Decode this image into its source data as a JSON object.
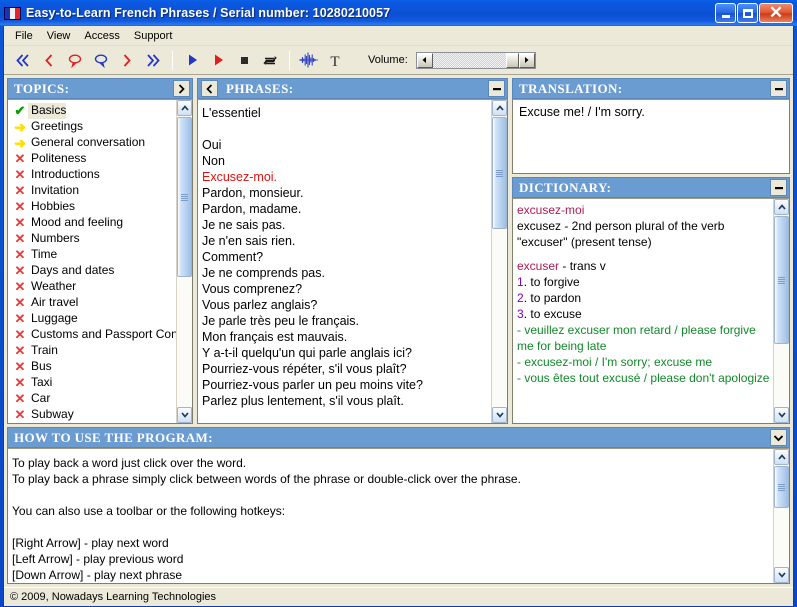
{
  "window": {
    "title": "Easy-to-Learn French Phrases / Serial number: 10280210057",
    "icon": "french-flag-icon",
    "buttons": {
      "minimize": "minimize",
      "maximize": "maximize",
      "close": "close"
    }
  },
  "menu": {
    "items": [
      "File",
      "View",
      "Access",
      "Support"
    ]
  },
  "toolbar": {
    "buttons": [
      {
        "name": "first-phrase-button",
        "icon": "double-chevron-left-icon",
        "color": "#2436c8"
      },
      {
        "name": "previous-word-button",
        "icon": "chevron-left-icon",
        "color": "#e02020"
      },
      {
        "name": "previous-phrase-button",
        "icon": "speech-bubble-left-icon",
        "color": "#e02020"
      },
      {
        "name": "next-phrase-button",
        "icon": "speech-bubble-right-icon",
        "color": "#2436c8"
      },
      {
        "name": "next-word-button",
        "icon": "chevron-right-icon",
        "color": "#e02020"
      },
      {
        "name": "last-phrase-button",
        "icon": "double-chevron-right-icon",
        "color": "#2436c8"
      },
      {
        "name": "play-button",
        "icon": "play-triangle-blue-icon",
        "color": "#2436c8"
      },
      {
        "name": "record-button",
        "icon": "play-triangle-red-icon",
        "color": "#e02020"
      },
      {
        "name": "stop-button",
        "icon": "stop-square-icon",
        "color": "#2b2b2b"
      },
      {
        "name": "repeat-button",
        "icon": "repeat-loop-icon",
        "color": "#1a1a1a"
      },
      {
        "name": "waveform-button",
        "icon": "waveform-icon",
        "color": "#2436c8"
      },
      {
        "name": "text-button",
        "icon": "text-t-icon",
        "color": "#2b2b2b"
      }
    ],
    "volume_label": "Volume:",
    "volume_value": 100
  },
  "topics": {
    "header": "TOPICS:",
    "expand_button": "›",
    "items": [
      {
        "label": "Basics",
        "status": "done",
        "icon": "check-icon",
        "selected": true
      },
      {
        "label": "Greetings",
        "status": "arrow",
        "icon": "arrow-right-icon",
        "selected": false
      },
      {
        "label": "General conversation",
        "status": "arrow",
        "icon": "arrow-right-icon",
        "selected": false
      },
      {
        "label": "Politeness",
        "status": "cross",
        "icon": "cross-icon",
        "selected": false
      },
      {
        "label": "Introductions",
        "status": "cross",
        "icon": "cross-icon",
        "selected": false
      },
      {
        "label": "Invitation",
        "status": "cross",
        "icon": "cross-icon",
        "selected": false
      },
      {
        "label": "Hobbies",
        "status": "cross",
        "icon": "cross-icon",
        "selected": false
      },
      {
        "label": "Mood and feeling",
        "status": "cross",
        "icon": "cross-icon",
        "selected": false
      },
      {
        "label": "Numbers",
        "status": "cross",
        "icon": "cross-icon",
        "selected": false
      },
      {
        "label": "Time",
        "status": "cross",
        "icon": "cross-icon",
        "selected": false
      },
      {
        "label": "Days and dates",
        "status": "cross",
        "icon": "cross-icon",
        "selected": false
      },
      {
        "label": "Weather",
        "status": "cross",
        "icon": "cross-icon",
        "selected": false
      },
      {
        "label": "Air travel",
        "status": "cross",
        "icon": "cross-icon",
        "selected": false
      },
      {
        "label": "Luggage",
        "status": "cross",
        "icon": "cross-icon",
        "selected": false
      },
      {
        "label": "Customs and Passport Con...",
        "status": "cross",
        "icon": "cross-icon",
        "selected": false
      },
      {
        "label": "Train",
        "status": "cross",
        "icon": "cross-icon",
        "selected": false
      },
      {
        "label": "Bus",
        "status": "cross",
        "icon": "cross-icon",
        "selected": false
      },
      {
        "label": "Taxi",
        "status": "cross",
        "icon": "cross-icon",
        "selected": false
      },
      {
        "label": "Car",
        "status": "cross",
        "icon": "cross-icon",
        "selected": false
      },
      {
        "label": "Subway",
        "status": "cross",
        "icon": "cross-icon",
        "selected": false
      }
    ]
  },
  "phrases": {
    "header": "PHRASES:",
    "collapse_left_button": "‹",
    "minimize_button": "–",
    "lines": [
      {
        "text": "L'essentiel",
        "highlight": false
      },
      {
        "text": "",
        "highlight": false
      },
      {
        "text": "Oui",
        "highlight": false
      },
      {
        "text": "Non",
        "highlight": false
      },
      {
        "text": "Excusez-moi.",
        "highlight": true
      },
      {
        "text": "Pardon, monsieur.",
        "highlight": false
      },
      {
        "text": "Pardon, madame.",
        "highlight": false
      },
      {
        "text": "Je ne sais pas.",
        "highlight": false
      },
      {
        "text": "Je n'en sais rien.",
        "highlight": false
      },
      {
        "text": "Comment?",
        "highlight": false
      },
      {
        "text": "Je ne comprends pas.",
        "highlight": false
      },
      {
        "text": "Vous comprenez?",
        "highlight": false
      },
      {
        "text": "Vous parlez anglais?",
        "highlight": false
      },
      {
        "text": "Je parle très peu le français.",
        "highlight": false
      },
      {
        "text": "Mon français est mauvais.",
        "highlight": false
      },
      {
        "text": "Y a-t-il quelqu'un qui parle anglais ici?",
        "highlight": false
      },
      {
        "text": "Pourriez-vous répéter, s'il vous plaît?",
        "highlight": false
      },
      {
        "text": "Pourriez-vous parler un peu moins vite?",
        "highlight": false
      },
      {
        "text": "Parlez plus lentement, s'il vous plaît.",
        "highlight": false
      }
    ]
  },
  "translation": {
    "header": "TRANSLATION:",
    "minimize_button": "–",
    "text": "Excuse me! / I'm sorry."
  },
  "dictionary": {
    "header": "DICTIONARY:",
    "minimize_button": "–",
    "entries": [
      {
        "kind": "head",
        "text": "excusez-moi"
      },
      {
        "kind": "plain",
        "text": "excusez - 2nd person plural of the verb \"excuser\" (present tense)"
      },
      {
        "kind": "blank",
        "text": ""
      },
      {
        "kind": "headline",
        "head": "excuser",
        "rest": " - trans v"
      },
      {
        "kind": "sense",
        "num": "1",
        "text": ". to forgive"
      },
      {
        "kind": "sense",
        "num": "2",
        "text": ". to pardon"
      },
      {
        "kind": "sense",
        "num": "3",
        "text": ". to excuse"
      },
      {
        "kind": "example",
        "text": " - veuillez excuser mon retard / please forgive me for being late"
      },
      {
        "kind": "example",
        "text": " - excusez-moi / I'm sorry; excuse me"
      },
      {
        "kind": "example",
        "text": " - vous êtes tout excusé / please don't apologize"
      }
    ]
  },
  "howto": {
    "header": "HOW TO USE THE PROGRAM:",
    "collapse_button": "⌄",
    "text": "To play back a word just click over the word.\nTo play back a phrase simply click between words of the phrase or double-click over the phrase.\n\nYou can also use a toolbar or the following hotkeys:\n\n[Right Arrow] - play next word\n[Left Arrow] - play previous word\n[Down Arrow] - play next phrase"
  },
  "statusbar": {
    "text": "© 2009, Nowadays Learning Technologies"
  }
}
